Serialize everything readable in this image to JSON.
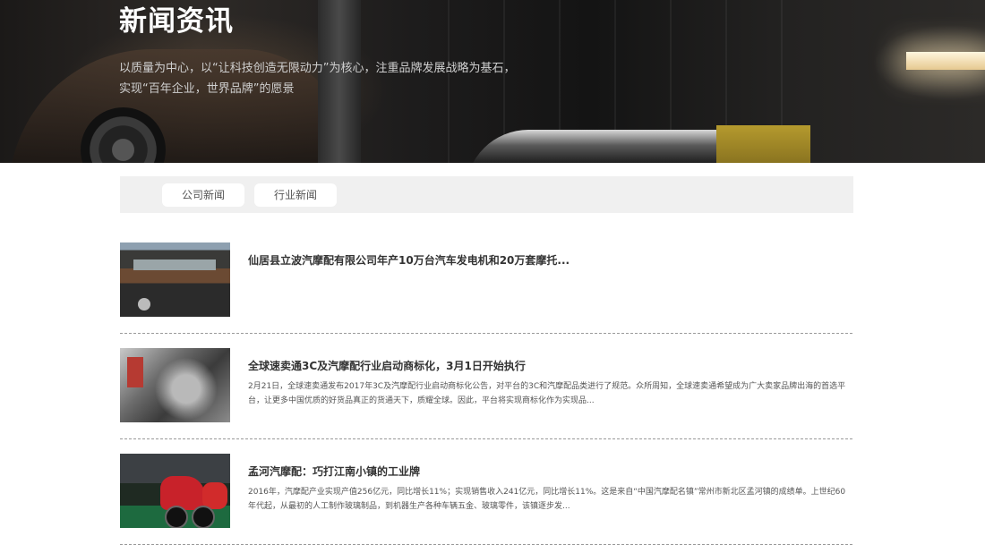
{
  "banner": {
    "title": "新闻资讯",
    "desc_line1": "以质量为中心，以“让科技创造无限动力”为核心，注重品牌发展战略为基石，",
    "desc_line2": "实现“百年企业，世界品牌”的愿景"
  },
  "tabs": [
    {
      "label": "公司新闻"
    },
    {
      "label": "行业新闻"
    }
  ],
  "news": [
    {
      "title": "仙居县立波汽摩配有限公司年产10万台汽车发电机和20万套摩托...",
      "desc": ""
    },
    {
      "title": "全球速卖通3C及汽摩配行业启动商标化，3月1日开始执行",
      "desc": "2月21日，全球速卖通发布2017年3C及汽摩配行业启动商标化公告，对平台的3C和汽摩配品类进行了规范。众所周知，全球速卖通希望成为广大卖家品牌出海的首选平台，让更多中国优质的好货品真正的货通天下，质耀全球。因此，平台将实现商标化作为实现品..."
    },
    {
      "title": "孟河汽摩配：巧打江南小镇的工业牌",
      "desc": "2016年，汽摩配产业实现产值256亿元，同比增长11%；实现销售收入241亿元，同比增长11%。这是来自“中国汽摩配名镇”常州市新北区孟河镇的成绩单。上世纪60年代起，从最初的人工制作玻璃制品，到机器生产各种车辆五金、玻璃零件，该镇逐步发..."
    }
  ]
}
